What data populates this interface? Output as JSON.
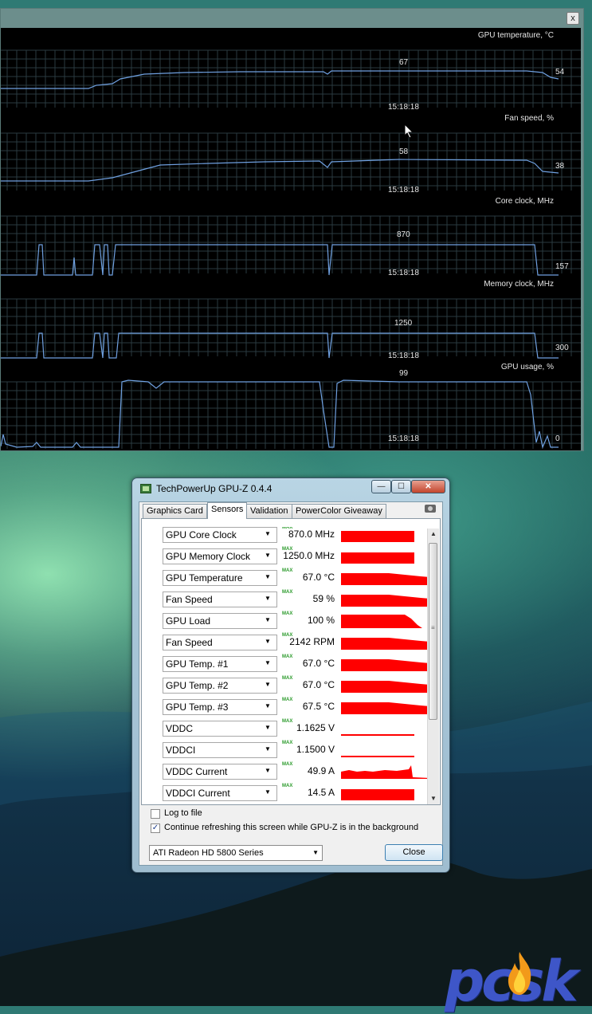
{
  "monitor": {
    "close_label": "x",
    "graphs": [
      {
        "title": "GPU temperature, °C",
        "max": "67",
        "time": "15:18:18",
        "current": "54"
      },
      {
        "title": "Fan speed, %",
        "max": "58",
        "time": "15:18:18",
        "current": "38"
      },
      {
        "title": "Core clock, MHz",
        "max": "870",
        "time": "15:18:18",
        "current": "157"
      },
      {
        "title": "Memory clock, MHz",
        "max": "1250",
        "time": "15:18:18",
        "current": "300"
      },
      {
        "title": "GPU usage, %",
        "max": "99",
        "time": "15:18:18",
        "current": "0"
      }
    ],
    "line_color": "#6fa0e0",
    "grid_color": "#2a3a40"
  },
  "gpuz": {
    "title": "TechPowerUp GPU-Z 0.4.4",
    "minimize_label": "—",
    "maximize_label": "☐",
    "close_label": "✕",
    "tabs": [
      "Graphics Card",
      "Sensors",
      "Validation",
      "PowerColor Giveaway"
    ],
    "active_tab": "Sensors",
    "max_tag": "MAX",
    "sensors": [
      {
        "name": "GPU Core Clock",
        "value": "870.0 MHz"
      },
      {
        "name": "GPU Memory Clock",
        "value": "1250.0 MHz"
      },
      {
        "name": "GPU Temperature",
        "value": "67.0 °C"
      },
      {
        "name": "Fan Speed",
        "value": "59 %"
      },
      {
        "name": "GPU Load",
        "value": "100 %"
      },
      {
        "name": "Fan Speed",
        "value": "2142 RPM"
      },
      {
        "name": "GPU Temp. #1",
        "value": "67.0 °C"
      },
      {
        "name": "GPU Temp. #2",
        "value": "67.0 °C"
      },
      {
        "name": "GPU Temp. #3",
        "value": "67.5 °C"
      },
      {
        "name": "VDDC",
        "value": "1.1625 V"
      },
      {
        "name": "VDDCI",
        "value": "1.1500 V"
      },
      {
        "name": "VDDC Current",
        "value": "49.9 A"
      },
      {
        "name": "VDDCI Current",
        "value": "14.5 A"
      }
    ],
    "log_to_file_label": "Log to file",
    "log_to_file_checked": "",
    "continue_refresh_label": "Continue refreshing this screen while GPU-Z is in the background",
    "continue_refresh_checked": "✓",
    "card_select_value": "ATI Radeon HD 5800 Series",
    "close_button_label": "Close",
    "sensor_graph_color": "#ff0000"
  },
  "watermark": {
    "text": "pcsk"
  }
}
